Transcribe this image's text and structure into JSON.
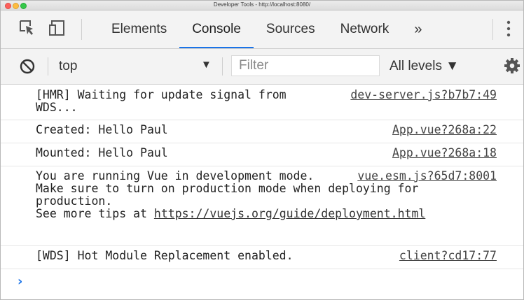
{
  "window": {
    "title": "Developer Tools - http://localhost:8080/"
  },
  "tabs": [
    {
      "label": "Elements"
    },
    {
      "label": "Console",
      "active": true
    },
    {
      "label": "Sources"
    },
    {
      "label": "Network"
    }
  ],
  "more_tabs": "»",
  "toolbar": {
    "context": "top",
    "context_arrow": "▼",
    "filter_placeholder": "Filter",
    "levels": "All levels ▼"
  },
  "messages": [
    {
      "text": "[HMR] Waiting for update signal from WDS...",
      "source": "dev-server.js?b7b7:49"
    },
    {
      "text": "Created: Hello Paul",
      "source": "App.vue?268a:22"
    },
    {
      "text": "Mounted: Hello Paul",
      "source": "App.vue?268a:18"
    },
    {
      "text_line1": "You are running Vue in development mode.",
      "text_line2": "Make sure to turn on production mode when deploying for production.",
      "text_line3_prefix": "See more tips at ",
      "text_link": "https://vuejs.org/guide/deployment.html",
      "source": "vue.esm.js?65d7:8001"
    },
    {
      "text": "[WDS] Hot Module Replacement enabled.",
      "source": "client?cd17:77"
    }
  ],
  "prompt": "›",
  "colors": {
    "accent": "#1a73e8",
    "close": "#fc605c",
    "minimize": "#fdbc40",
    "maximize": "#34c84a"
  },
  "icons": [
    "inspect-element-icon",
    "device-toolbar-icon",
    "kebab-menu-icon",
    "clear-console-icon",
    "settings-gear-icon"
  ]
}
